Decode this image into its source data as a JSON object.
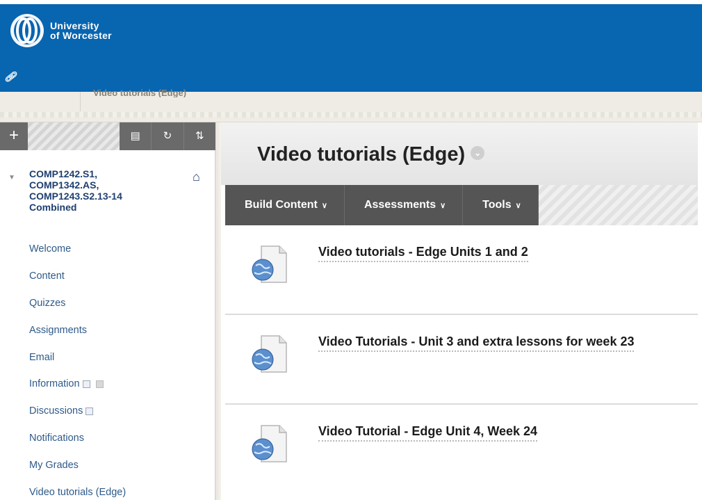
{
  "header": {
    "logo_line1": "University",
    "logo_line2": "of Worcester",
    "brand_color": "#0865b0"
  },
  "breadcrumb": {
    "current": "Video tutorials (Edge)"
  },
  "sidebar": {
    "toolbar": {
      "add_icon": "plus-icon",
      "folder_icon": "folder-icon",
      "refresh_icon": "refresh-icon",
      "sort_icon": "sort-icon"
    },
    "course": {
      "line1": "COMP1242.S1,",
      "line2": "COMP1342.AS,",
      "line3": "COMP1243.S2.13-14",
      "line4": "Combined"
    },
    "items": [
      {
        "label": "Welcome"
      },
      {
        "label": "Content"
      },
      {
        "label": "Quizzes"
      },
      {
        "label": "Assignments"
      },
      {
        "label": "Email"
      },
      {
        "label": "Information"
      },
      {
        "label": "Discussions"
      },
      {
        "label": "Notifications"
      },
      {
        "label": "My Grades"
      },
      {
        "label": "Video tutorials (Edge)"
      }
    ]
  },
  "main": {
    "title": "Video tutorials (Edge)",
    "menus": [
      {
        "label": "Build Content"
      },
      {
        "label": "Assessments"
      },
      {
        "label": "Tools"
      }
    ],
    "content_items": [
      {
        "title": "Video tutorials - Edge Units 1 and 2"
      },
      {
        "title": "Video Tutorials - Unit 3 and extra lessons for week 23"
      },
      {
        "title": "Video Tutorial - Edge Unit 4, Week 24"
      }
    ]
  }
}
